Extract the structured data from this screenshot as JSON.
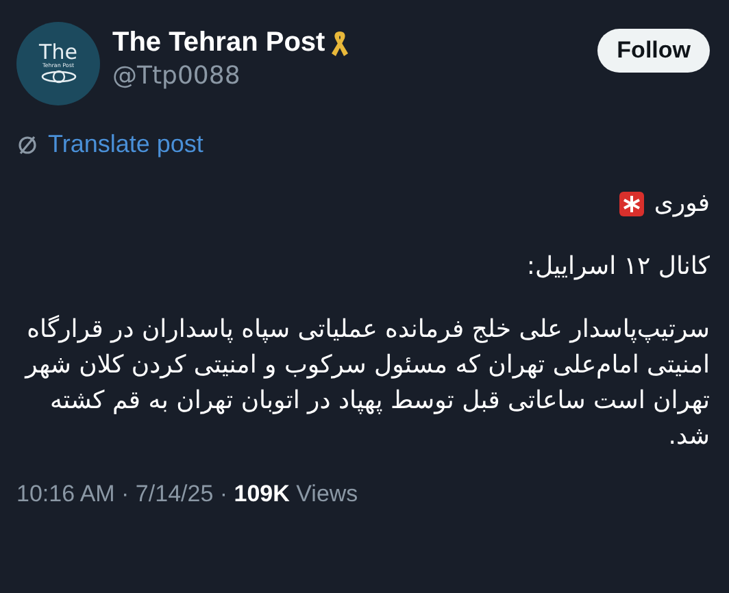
{
  "author": {
    "avatar_text": "The",
    "avatar_subtext": "Tehran Post",
    "name": "The Tehran Post",
    "handle": "@Ttp0088"
  },
  "follow_button": "Follow",
  "translate_link": "Translate post",
  "post": {
    "paragraphs": [
      {
        "text": "فوری",
        "kind": "siren"
      },
      {
        "text": "کانال ۱۲ اسراییل:",
        "kind": "plain"
      },
      {
        "text": "سرتیپ‌پاسدار علی خلج فرمانده عملیاتی سپاه پاسداران در قرارگاه امنیتی امام‌علی تهران که مسئول سرکوب و امنیتی کردن کلان شهر تهران است ساعاتی قبل توسط پهپاد در اتوبان تهران به قم کشته شد.",
        "kind": "plain"
      }
    ]
  },
  "meta": "10:16 AM · 7/14/25 · **109K** Views"
}
